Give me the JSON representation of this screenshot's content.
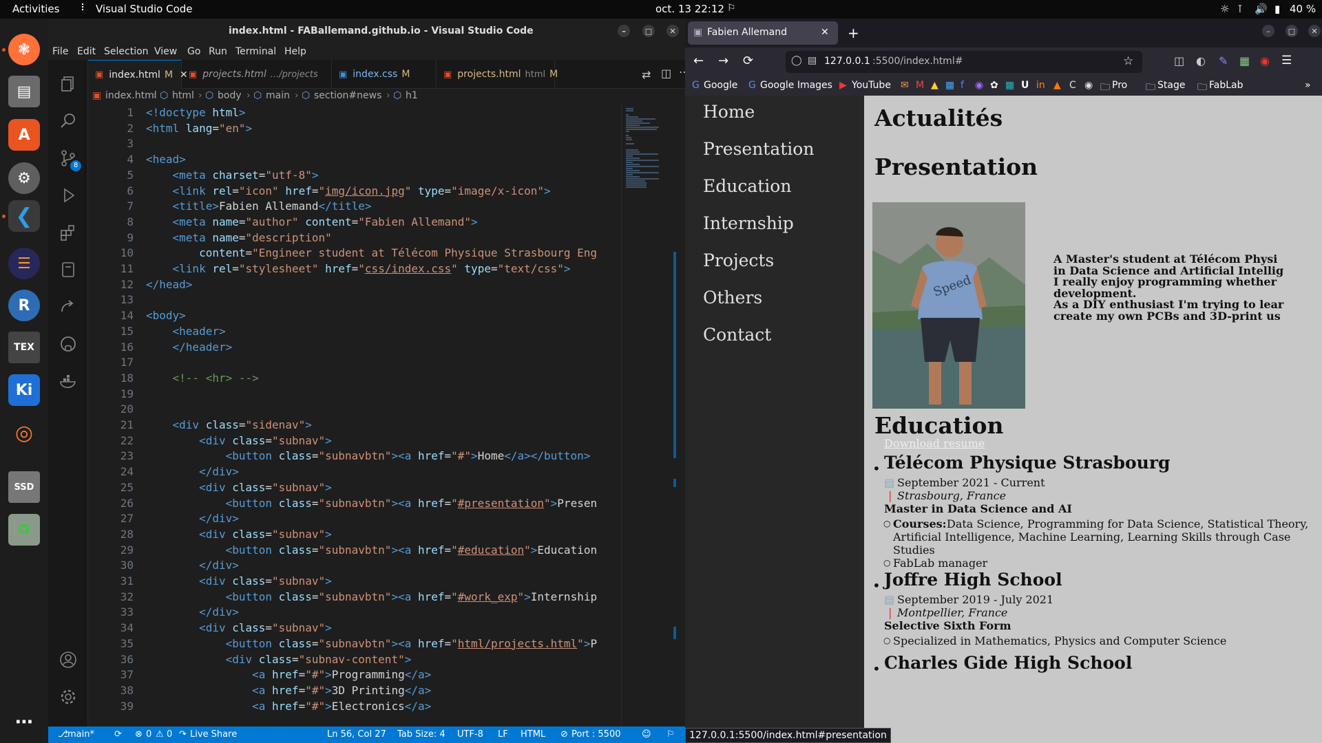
{
  "topbar": {
    "activities": "Activities",
    "app_name": "Visual Studio Code",
    "clock": "oct. 13  22:12",
    "battery": "40 %"
  },
  "vscode": {
    "title": "index.html - FABallemand.github.io - Visual Studio Code",
    "menu": [
      "File",
      "Edit",
      "Selection",
      "View",
      "Go",
      "Run",
      "Terminal",
      "Help"
    ],
    "scm_badge": "8",
    "tabs": [
      {
        "label": "index.html",
        "status": "M",
        "desc": ""
      },
      {
        "label": "projects.html",
        "status": "",
        "desc": ".../projects"
      },
      {
        "label": "index.css",
        "status": "M",
        "desc": ""
      },
      {
        "label": "projects.html",
        "status": "M",
        "desc": "html"
      }
    ],
    "breadcrumb": [
      "index.html",
      "html",
      "body",
      "main",
      "section#news",
      "h1"
    ],
    "line_numbers": [
      "1",
      "2",
      "3",
      "4",
      "5",
      "6",
      "7",
      "8",
      "9",
      "10",
      "11",
      "12",
      "13",
      "14",
      "15",
      "16",
      "17",
      "18",
      "19",
      "20",
      "21",
      "22",
      "23",
      "24",
      "25",
      "26",
      "27",
      "28",
      "29",
      "30",
      "31",
      "32",
      "33",
      "34",
      "35",
      "36",
      "37",
      "38",
      "39"
    ],
    "status": {
      "branch": "main*",
      "problems": "0",
      "warnings": "0",
      "live_share": "Live Share",
      "cursor": "Ln 56, Col 27",
      "tab_size": "Tab Size: 4",
      "encoding": "UTF-8",
      "eol": "LF",
      "language": "HTML",
      "port": "Port : 5500"
    }
  },
  "code_lines": [
    [
      [
        "tg",
        "<!doctype "
      ],
      [
        "at",
        "html"
      ],
      [
        "tg",
        ">"
      ]
    ],
    [
      [
        "tg",
        "<html "
      ],
      [
        "at",
        "lang"
      ],
      [
        "tx",
        "="
      ],
      [
        "st",
        "\"en\""
      ],
      [
        "tg",
        ">"
      ]
    ],
    [],
    [
      [
        "tg",
        "<head>"
      ]
    ],
    [
      [
        "tx",
        "    "
      ],
      [
        "tg",
        "<meta "
      ],
      [
        "at",
        "charset"
      ],
      [
        "tx",
        "="
      ],
      [
        "st",
        "\"utf-8\""
      ],
      [
        "tg",
        ">"
      ]
    ],
    [
      [
        "tx",
        "    "
      ],
      [
        "tg",
        "<link "
      ],
      [
        "at",
        "rel"
      ],
      [
        "tx",
        "="
      ],
      [
        "st",
        "\"icon\" "
      ],
      [
        "at",
        "href"
      ],
      [
        "tx",
        "="
      ],
      [
        "st",
        "\""
      ],
      [
        "stu",
        "img/icon.jpg"
      ],
      [
        "st",
        "\" "
      ],
      [
        "at",
        "type"
      ],
      [
        "tx",
        "="
      ],
      [
        "st",
        "\"image/x-icon\""
      ],
      [
        "tg",
        ">"
      ]
    ],
    [
      [
        "tx",
        "    "
      ],
      [
        "tg",
        "<title>"
      ],
      [
        "tx",
        "Fabien Allemand"
      ],
      [
        "tg",
        "</title>"
      ]
    ],
    [
      [
        "tx",
        "    "
      ],
      [
        "tg",
        "<meta "
      ],
      [
        "at",
        "name"
      ],
      [
        "tx",
        "="
      ],
      [
        "st",
        "\"author\" "
      ],
      [
        "at",
        "content"
      ],
      [
        "tx",
        "="
      ],
      [
        "st",
        "\"Fabien Allemand\""
      ],
      [
        "tg",
        ">"
      ]
    ],
    [
      [
        "tx",
        "    "
      ],
      [
        "tg",
        "<meta "
      ],
      [
        "at",
        "name"
      ],
      [
        "tx",
        "="
      ],
      [
        "st",
        "\"description\""
      ]
    ],
    [
      [
        "tx",
        "        "
      ],
      [
        "at",
        "content"
      ],
      [
        "tx",
        "="
      ],
      [
        "st",
        "\"Engineer student at Télécom Physique Strasbourg Eng"
      ]
    ],
    [
      [
        "tx",
        "    "
      ],
      [
        "tg",
        "<link "
      ],
      [
        "at",
        "rel"
      ],
      [
        "tx",
        "="
      ],
      [
        "st",
        "\"stylesheet\" "
      ],
      [
        "at",
        "href"
      ],
      [
        "tx",
        "="
      ],
      [
        "st",
        "\""
      ],
      [
        "stu",
        "css/index.css"
      ],
      [
        "st",
        "\" "
      ],
      [
        "at",
        "type"
      ],
      [
        "tx",
        "="
      ],
      [
        "st",
        "\"text/css\""
      ],
      [
        "tg",
        ">"
      ]
    ],
    [
      [
        "tg",
        "</head>"
      ]
    ],
    [],
    [
      [
        "tg",
        "<body>"
      ]
    ],
    [
      [
        "tx",
        "    "
      ],
      [
        "tg",
        "<header>"
      ]
    ],
    [
      [
        "tx",
        "    "
      ],
      [
        "tg",
        "</header>"
      ]
    ],
    [],
    [
      [
        "tx",
        "    "
      ],
      [
        "cm",
        "<!-- <hr> -->"
      ]
    ],
    [],
    [],
    [
      [
        "tx",
        "    "
      ],
      [
        "tg",
        "<div "
      ],
      [
        "at",
        "class"
      ],
      [
        "tx",
        "="
      ],
      [
        "st",
        "\"sidenav\""
      ],
      [
        "tg",
        ">"
      ]
    ],
    [
      [
        "tx",
        "        "
      ],
      [
        "tg",
        "<div "
      ],
      [
        "at",
        "class"
      ],
      [
        "tx",
        "="
      ],
      [
        "st",
        "\"subnav\""
      ],
      [
        "tg",
        ">"
      ]
    ],
    [
      [
        "tx",
        "            "
      ],
      [
        "tg",
        "<button "
      ],
      [
        "at",
        "class"
      ],
      [
        "tx",
        "="
      ],
      [
        "st",
        "\"subnavbtn\""
      ],
      [
        "tg",
        "><a "
      ],
      [
        "at",
        "href"
      ],
      [
        "tx",
        "="
      ],
      [
        "st",
        "\"#\""
      ],
      [
        "tg",
        ">"
      ],
      [
        "tx",
        "Home"
      ],
      [
        "tg",
        "</a></button>"
      ]
    ],
    [
      [
        "tx",
        "        "
      ],
      [
        "tg",
        "</div>"
      ]
    ],
    [
      [
        "tx",
        "        "
      ],
      [
        "tg",
        "<div "
      ],
      [
        "at",
        "class"
      ],
      [
        "tx",
        "="
      ],
      [
        "st",
        "\"subnav\""
      ],
      [
        "tg",
        ">"
      ]
    ],
    [
      [
        "tx",
        "            "
      ],
      [
        "tg",
        "<button "
      ],
      [
        "at",
        "class"
      ],
      [
        "tx",
        "="
      ],
      [
        "st",
        "\"subnavbtn\""
      ],
      [
        "tg",
        "><a "
      ],
      [
        "at",
        "href"
      ],
      [
        "tx",
        "="
      ],
      [
        "st",
        "\""
      ],
      [
        "stu",
        "#presentation"
      ],
      [
        "st",
        "\""
      ],
      [
        "tg",
        ">"
      ],
      [
        "tx",
        "Presen"
      ]
    ],
    [
      [
        "tx",
        "        "
      ],
      [
        "tg",
        "</div>"
      ]
    ],
    [
      [
        "tx",
        "        "
      ],
      [
        "tg",
        "<div "
      ],
      [
        "at",
        "class"
      ],
      [
        "tx",
        "="
      ],
      [
        "st",
        "\"subnav\""
      ],
      [
        "tg",
        ">"
      ]
    ],
    [
      [
        "tx",
        "            "
      ],
      [
        "tg",
        "<button "
      ],
      [
        "at",
        "class"
      ],
      [
        "tx",
        "="
      ],
      [
        "st",
        "\"subnavbtn\""
      ],
      [
        "tg",
        "><a "
      ],
      [
        "at",
        "href"
      ],
      [
        "tx",
        "="
      ],
      [
        "st",
        "\""
      ],
      [
        "stu",
        "#education"
      ],
      [
        "st",
        "\""
      ],
      [
        "tg",
        ">"
      ],
      [
        "tx",
        "Education"
      ]
    ],
    [
      [
        "tx",
        "        "
      ],
      [
        "tg",
        "</div>"
      ]
    ],
    [
      [
        "tx",
        "        "
      ],
      [
        "tg",
        "<div "
      ],
      [
        "at",
        "class"
      ],
      [
        "tx",
        "="
      ],
      [
        "st",
        "\"subnav\""
      ],
      [
        "tg",
        ">"
      ]
    ],
    [
      [
        "tx",
        "            "
      ],
      [
        "tg",
        "<button "
      ],
      [
        "at",
        "class"
      ],
      [
        "tx",
        "="
      ],
      [
        "st",
        "\"subnavbtn\""
      ],
      [
        "tg",
        "><a "
      ],
      [
        "at",
        "href"
      ],
      [
        "tx",
        "="
      ],
      [
        "st",
        "\""
      ],
      [
        "stu",
        "#work_exp"
      ],
      [
        "st",
        "\""
      ],
      [
        "tg",
        ">"
      ],
      [
        "tx",
        "Internship"
      ]
    ],
    [
      [
        "tx",
        "        "
      ],
      [
        "tg",
        "</div>"
      ]
    ],
    [
      [
        "tx",
        "        "
      ],
      [
        "tg",
        "<div "
      ],
      [
        "at",
        "class"
      ],
      [
        "tx",
        "="
      ],
      [
        "st",
        "\"subnav\""
      ],
      [
        "tg",
        ">"
      ]
    ],
    [
      [
        "tx",
        "            "
      ],
      [
        "tg",
        "<button "
      ],
      [
        "at",
        "class"
      ],
      [
        "tx",
        "="
      ],
      [
        "st",
        "\"subnavbtn\""
      ],
      [
        "tg",
        "><a "
      ],
      [
        "at",
        "href"
      ],
      [
        "tx",
        "="
      ],
      [
        "st",
        "\""
      ],
      [
        "stu",
        "html/projects.html"
      ],
      [
        "st",
        "\""
      ],
      [
        "tg",
        ">"
      ],
      [
        "tx",
        "P"
      ]
    ],
    [
      [
        "tx",
        "            "
      ],
      [
        "tg",
        "<div "
      ],
      [
        "at",
        "class"
      ],
      [
        "tx",
        "="
      ],
      [
        "st",
        "\"subnav-content\""
      ],
      [
        "tg",
        ">"
      ]
    ],
    [
      [
        "tx",
        "                "
      ],
      [
        "tg",
        "<a "
      ],
      [
        "at",
        "href"
      ],
      [
        "tx",
        "="
      ],
      [
        "st",
        "\"#\""
      ],
      [
        "tg",
        ">"
      ],
      [
        "tx",
        "Programming"
      ],
      [
        "tg",
        "</a>"
      ]
    ],
    [
      [
        "tx",
        "                "
      ],
      [
        "tg",
        "<a "
      ],
      [
        "at",
        "href"
      ],
      [
        "tx",
        "="
      ],
      [
        "st",
        "\"#\""
      ],
      [
        "tg",
        ">"
      ],
      [
        "tx",
        "3D Printing"
      ],
      [
        "tg",
        "</a>"
      ]
    ],
    [
      [
        "tx",
        "                "
      ],
      [
        "tg",
        "<a "
      ],
      [
        "at",
        "href"
      ],
      [
        "tx",
        "="
      ],
      [
        "st",
        "\"#\""
      ],
      [
        "tg",
        ">"
      ],
      [
        "tx",
        "Electronics"
      ],
      [
        "tg",
        "</a>"
      ]
    ]
  ],
  "browser": {
    "tab_title": "Fabien Allemand",
    "url_host": "127.0.0.1",
    "url_path": ":5500/index.html#",
    "bookmarks": [
      "Google",
      "Google Images",
      "YouTube",
      "Pro",
      "Stage",
      "FabLab"
    ],
    "status_url": "127.0.0.1:5500/index.html#presentation"
  },
  "page": {
    "nav": [
      "Home",
      "Presentation",
      "Education",
      "Internship",
      "Projects",
      "Others",
      "Contact"
    ],
    "news_heading": "Actualités",
    "presentation_heading": "Presentation",
    "intro_lines": [
      "A Master's student at Télécom Physi",
      "in Data Science and Artificial Intellig",
      "I really enjoy programming whether",
      "development.",
      "As a DIY enthusiast I'm trying to lear",
      "create my own PCBs and 3D-print us"
    ],
    "education_heading": "Education",
    "download_resume": "Download resume",
    "schools": [
      {
        "name": "Télécom Physique Strasbourg",
        "dates": "September 2021 - Current",
        "place": "Strasbourg, France",
        "degree": "Master in Data Science and AI"
      },
      {
        "name": "Joffre High School",
        "dates": "September 2019 - July 2021",
        "place": "Montpellier, France",
        "degree": "Selective Sixth Form"
      },
      {
        "name": "Charles Gide High School"
      }
    ],
    "courses_label": "Courses:",
    "courses_lines": [
      "Data Science, Programming for Data Science, Statistical Theory,",
      "Artificial Intelligence, Machine Learning, Learning Skills through Case",
      "Studies"
    ],
    "fablab": "FabLab manager",
    "joffre_detail": "Specialized in Mathematics, Physics and Computer Science"
  }
}
